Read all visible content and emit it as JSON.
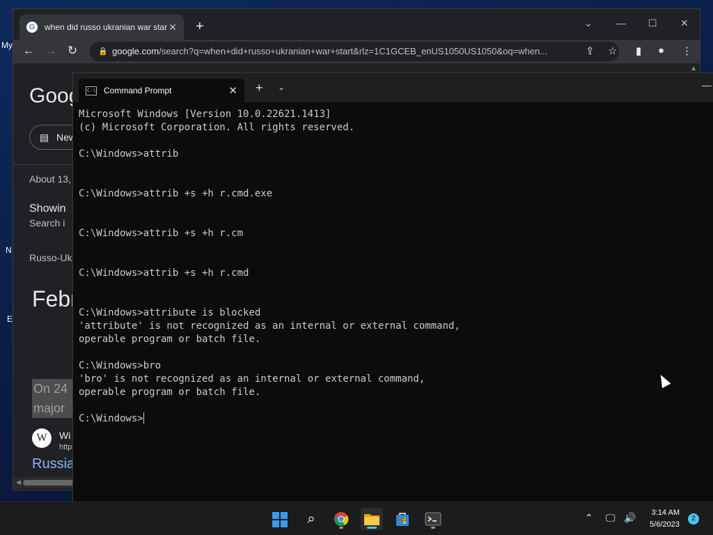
{
  "desktop": {
    "icons": [
      "My",
      "N",
      "E"
    ]
  },
  "chrome": {
    "tab_title": "when did russo ukranian war star",
    "tab_close": "✕",
    "new_tab": "+",
    "url_host": "google.com",
    "url_rest": "/search?q=when+did+russo+ukranian+war+start&rlz=1C1GCEB_enUS1050US1050&oq=when...",
    "content": {
      "logo": "Goog",
      "news_chip": "New",
      "about": "About 13,",
      "showing": "Showin",
      "search_in": "Search i",
      "breadcrumb": "Russo-Uk",
      "answer": "Febr",
      "snippet_line1": "On 24",
      "snippet_line2": "major",
      "wiki_name": "Wi",
      "wiki_url": "http",
      "result_link": "Russia"
    }
  },
  "terminal": {
    "tab_title": "Command Prompt",
    "tab_close": "✕",
    "new_tab": "+",
    "dropdown": "⌄",
    "lines": [
      "Microsoft Windows [Version 10.0.22621.1413]",
      "(c) Microsoft Corporation. All rights reserved.",
      "",
      "C:\\Windows>attrib",
      "",
      "",
      "C:\\Windows>attrib +s +h r.cmd.exe",
      "",
      "",
      "C:\\Windows>attrib +s +h r.cm",
      "",
      "",
      "C:\\Windows>attrib +s +h r.cmd",
      "",
      "",
      "C:\\Windows>attribute is blocked",
      "'attribute' is not recognized as an internal or external command,",
      "operable program or batch file.",
      "",
      "C:\\Windows>bro",
      "'bro' is not recognized as an internal or external command,",
      "operable program or batch file.",
      ""
    ],
    "prompt": "C:\\Windows>"
  },
  "taskbar": {
    "apps": [
      {
        "name": "start",
        "icon": "windows-logo-icon"
      },
      {
        "name": "search",
        "icon": "search-icon"
      },
      {
        "name": "chrome",
        "icon": "chrome-icon"
      },
      {
        "name": "file-explorer",
        "icon": "folder-icon"
      },
      {
        "name": "store",
        "icon": "store-icon"
      },
      {
        "name": "terminal",
        "icon": "terminal-icon"
      }
    ],
    "time": "3:14 AM",
    "date": "5/6/2023",
    "notification_count": "2"
  },
  "colors": {
    "terminal_bg": "#0c0c0c",
    "terminal_text": "#cccccc",
    "chrome_bg": "#202124",
    "accent": "#4cc2ff"
  }
}
